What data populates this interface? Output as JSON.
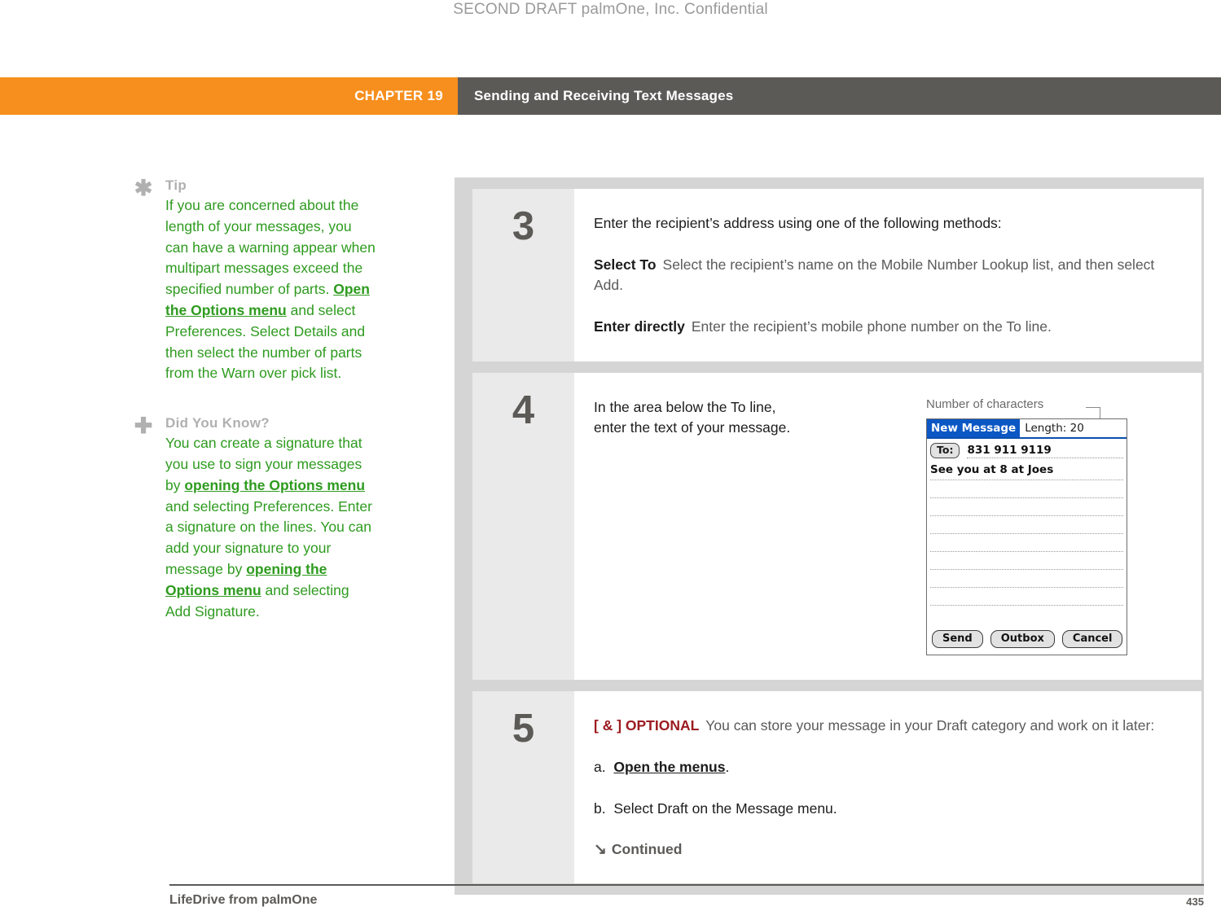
{
  "draft_header": "SECOND DRAFT palmOne, Inc.  Confidential",
  "colors": {
    "chapter_tab_bg": "#f78f1e",
    "chapter_title_bg": "#5c5a57",
    "note_text": "#2e9b1f",
    "note_heading": "#b0b0b0",
    "optional_tag": "#9b1b20",
    "step_frame": "#d5d5d5",
    "step_number_bg": "#eaeaea"
  },
  "chapter": {
    "tab_label": "CHAPTER 19",
    "title": "Sending and Receiving Text Messages"
  },
  "sidebar": {
    "notes": [
      {
        "icon": "asterisk-icon",
        "glyph": "✱",
        "heading": "Tip",
        "segments": [
          {
            "text": "If you are concerned about the length of your messages, you can have a warning appear when multipart messages exceed the specified number of parts. ",
            "link": false
          },
          {
            "text": "Open the Options menu",
            "link": true
          },
          {
            "text": " and select Preferences. Select Details and then select the number of parts from the Warn over pick list.",
            "link": false
          }
        ]
      },
      {
        "icon": "plus-icon",
        "glyph": "✚",
        "heading": "Did You Know?",
        "segments": [
          {
            "text": "You can create a signature that you use to sign your messages by ",
            "link": false
          },
          {
            "text": "opening the Options menu",
            "link": true
          },
          {
            "text": " and selecting Preferences. Enter a signature on the lines. You can add your signature to your message by ",
            "link": false
          },
          {
            "text": "opening the Options menu",
            "link": true
          },
          {
            "text": " and selecting Add Signature.",
            "link": false
          }
        ]
      }
    ]
  },
  "steps": [
    {
      "number": "3",
      "intro": "Enter the recipient’s address using one of the following methods:",
      "methods": [
        {
          "term": "Select To",
          "desc": "Select the recipient’s name on the Mobile Number Lookup list, and then select Add."
        },
        {
          "term": "Enter directly",
          "desc": "Enter the recipient’s mobile phone number on the To line."
        }
      ]
    },
    {
      "number": "4",
      "text_line_1": "In the area below the To line,",
      "text_line_2": "enter the text of your message.",
      "figure": {
        "callout": "Number of characters",
        "device": {
          "title": "New Message",
          "length_label": "Length: 20",
          "to_button": "To:",
          "to_value": "831 911 9119",
          "message_text": "See you at 8 at Joes",
          "empty_line_count": 8,
          "buttons": [
            "Send",
            "Outbox",
            "Cancel"
          ]
        }
      }
    },
    {
      "number": "5",
      "optional_tag": "[ & ]  OPTIONAL",
      "intro": "You can store your message in your Draft category and work on it later:",
      "sub_items": [
        {
          "marker": "a.",
          "pre": "",
          "link": "Open the menus",
          "post": "."
        },
        {
          "marker": "b.",
          "pre": "Select Draft on the Message menu.",
          "link": "",
          "post": ""
        }
      ],
      "continued_arrow": "↘",
      "continued_label": "Continued"
    }
  ],
  "footer": {
    "left": "LifeDrive from palmOne",
    "page": "435"
  }
}
